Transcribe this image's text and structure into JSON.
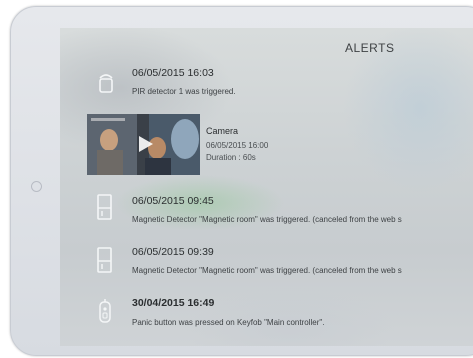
{
  "header": {
    "title": "ALERTS"
  },
  "alerts": [
    {
      "icon": "pir-detector-icon",
      "timestamp": "06/05/2015 16:03",
      "message": "PIR detector 1 was triggered."
    },
    {
      "icon": "magnetic-detector-icon",
      "timestamp": "06/05/2015 09:45",
      "message": "Magnetic Detector \"Magnetic room\" was triggered. (canceled from the web s"
    },
    {
      "icon": "magnetic-detector-icon",
      "timestamp": "06/05/2015 09:39",
      "message": "Magnetic Detector \"Magnetic room\" was triggered. (canceled from the web s"
    },
    {
      "icon": "keyfob-icon",
      "timestamp": "30/04/2015 16:49",
      "message": "Panic button was pressed on Keyfob \"Main controller\"."
    }
  ],
  "camera": {
    "label": "Camera",
    "timestamp": "06/05/2015 16:00",
    "duration": "Duration : 60s",
    "icon": "play-icon"
  },
  "colors": {
    "text": "#2b2e30",
    "frame": "#e6e8ec"
  }
}
